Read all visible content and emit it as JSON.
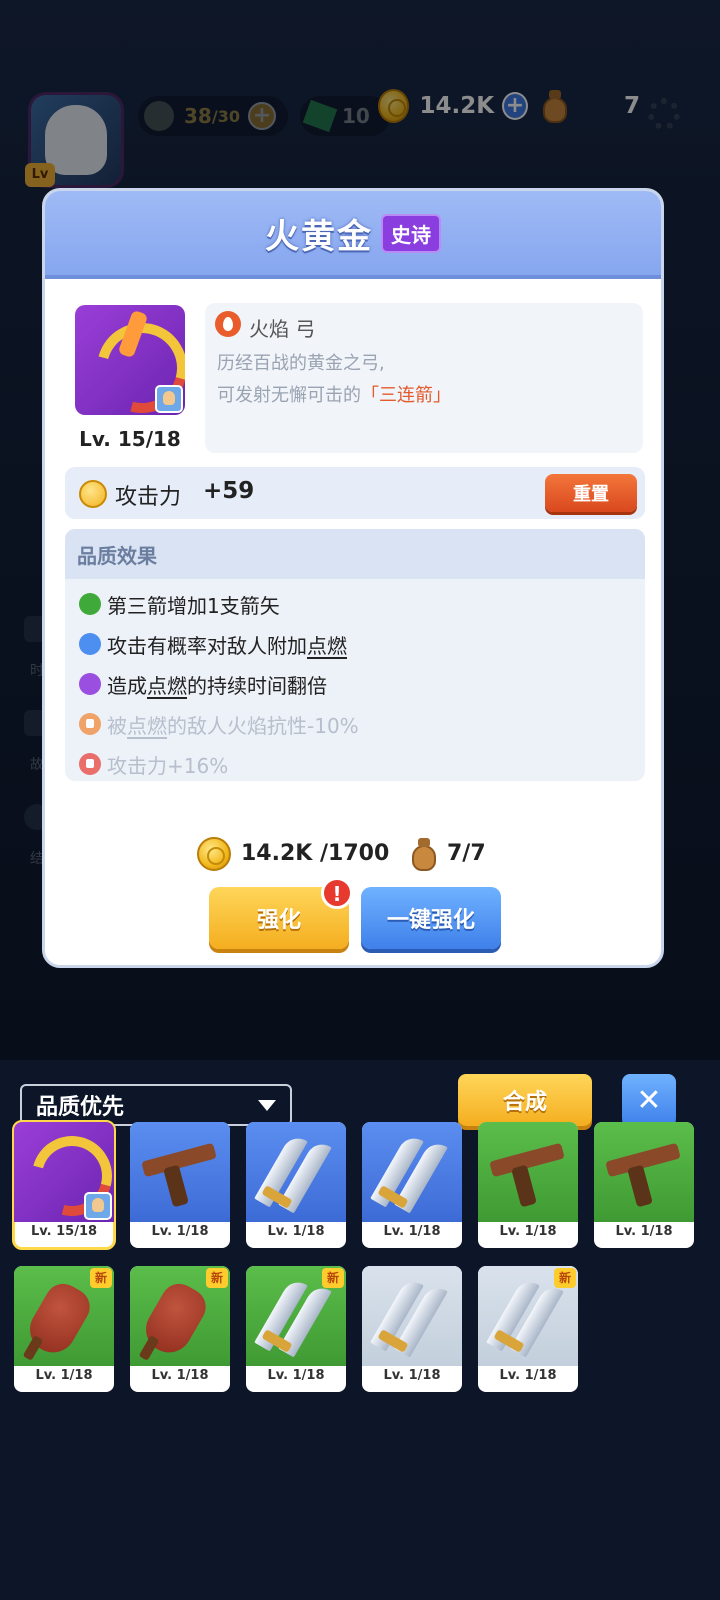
{
  "hud": {
    "energy": "38",
    "energy_max": "/30",
    "gems": "10",
    "coins": "14.2K",
    "bags": "7"
  },
  "side_menu": [
    "时",
    "故",
    "结"
  ],
  "dialog": {
    "title": "火黄金",
    "rarity": "史诗",
    "level": "Lv. 15/18",
    "weapon_type": "火焰 弓",
    "desc_line1": "历经百战的黄金之弓,",
    "desc_line2_prefix": "可发射无懈可击的",
    "desc_line2_highlight": "「三连箭」",
    "stat_label": "攻击力",
    "stat_value": "+59",
    "reset_label": "重置",
    "quality_title": "品质效果",
    "quality_effects": [
      {
        "parts": [
          "第三箭增加1支箭矢"
        ],
        "color": "#3faa3a",
        "locked": false
      },
      {
        "parts": [
          "攻击有概率对敌人附加",
          "点燃"
        ],
        "color": "#4d8ff0",
        "locked": false
      },
      {
        "parts": [
          "造成",
          "点燃",
          "的持续时间翻倍"
        ],
        "color": "#9b4fe0",
        "locked": false
      },
      {
        "parts": [
          "被",
          "点燃",
          "的敌人火焰抗性-10%"
        ],
        "color": "#f08a3a",
        "locked": true
      },
      {
        "parts": [
          "攻击力+16%"
        ],
        "color": "#e8423b",
        "locked": true
      }
    ],
    "cost_coins": "14.2K /1700",
    "cost_bags": "7/7",
    "upgrade_label": "强化",
    "alert_mark": "!",
    "one_key_label": "一键强化"
  },
  "inventory": {
    "sort_label": "品质优先",
    "merge_label": "合成",
    "close_label": "✕",
    "new_label": "新",
    "items": [
      {
        "name": "火黄金",
        "kind": "bow",
        "bg": "purple",
        "level": "Lv. 15/18",
        "selected": true,
        "new": false
      },
      {
        "kind": "crossbow",
        "bg": "blue",
        "level": "Lv. 1/18",
        "new": false
      },
      {
        "kind": "blades",
        "bg": "blue",
        "level": "Lv. 1/18",
        "new": false
      },
      {
        "kind": "blades",
        "bg": "blue",
        "level": "Lv. 1/18",
        "new": false
      },
      {
        "kind": "crossbow",
        "bg": "green",
        "level": "Lv. 1/18",
        "new": false
      },
      {
        "kind": "crossbow",
        "bg": "green",
        "level": "Lv. 1/18",
        "new": false
      },
      {
        "kind": "club",
        "bg": "green",
        "level": "Lv. 1/18",
        "new": true
      },
      {
        "kind": "club",
        "bg": "green",
        "level": "Lv. 1/18",
        "new": true
      },
      {
        "kind": "blades",
        "bg": "green",
        "level": "Lv. 1/18",
        "new": true
      },
      {
        "kind": "blades",
        "bg": "grey",
        "level": "Lv. 1/18",
        "new": false
      },
      {
        "kind": "blades",
        "bg": "grey",
        "level": "Lv. 1/18",
        "new": true
      }
    ]
  }
}
